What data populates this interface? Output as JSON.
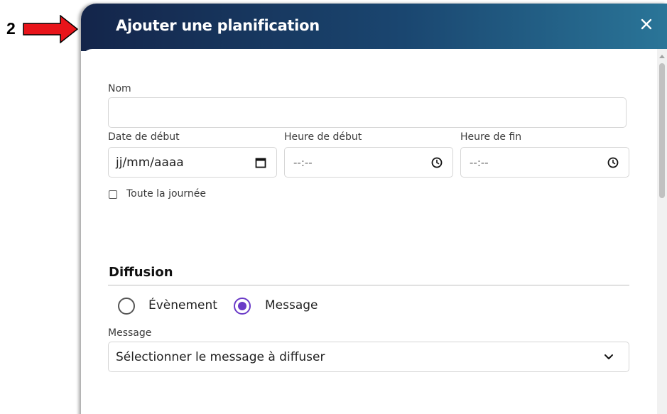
{
  "annotation": {
    "step_number": "2"
  },
  "dialog": {
    "title": "Ajouter une planification",
    "close_icon": "close-icon"
  },
  "form": {
    "name": {
      "label": "Nom",
      "value": ""
    },
    "start_date": {
      "label": "Date de début",
      "placeholder": "jj/mm/aaaa",
      "icon": "calendar-icon"
    },
    "start_time": {
      "label": "Heure de début",
      "placeholder": "--:--",
      "icon": "clock-icon"
    },
    "end_time": {
      "label": "Heure de fin",
      "placeholder": "--:--",
      "icon": "clock-icon"
    },
    "all_day": {
      "label": "Toute la journée",
      "checked": false
    }
  },
  "diffusion": {
    "title": "Diffusion",
    "options": [
      {
        "label": "Évènement",
        "selected": false
      },
      {
        "label": "Message",
        "selected": true
      }
    ],
    "message_label": "Message",
    "message_select": "Sélectionner le message à diffuser",
    "accent_color": "#6a3ac7"
  },
  "colors": {
    "header_start": "#14254a",
    "header_end": "#2a7598",
    "annotation_arrow": "#e8141a"
  }
}
